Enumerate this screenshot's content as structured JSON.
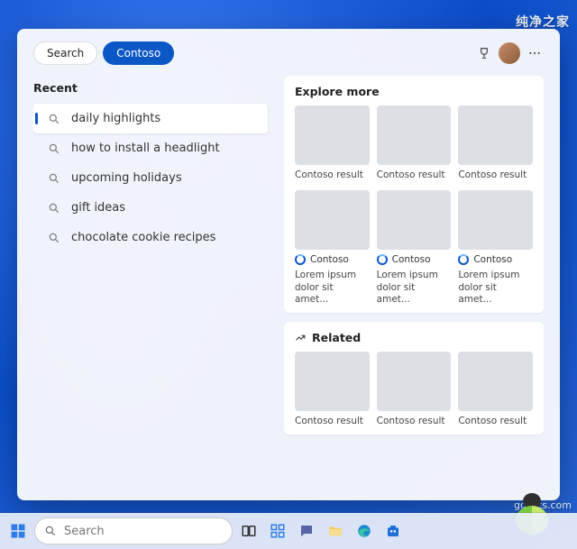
{
  "header": {
    "tab_search": "Search",
    "tab_contoso": "Contoso"
  },
  "recent": {
    "title": "Recent",
    "items": [
      "daily highlights",
      "how to install a headlight",
      "upcoming holidays",
      "gift ideas",
      "chocolate cookie recipes"
    ]
  },
  "explore": {
    "title": "Explore more",
    "row1": [
      {
        "caption": "Contoso result"
      },
      {
        "caption": "Contoso result"
      },
      {
        "caption": "Contoso result"
      }
    ],
    "row2": [
      {
        "badge": "Contoso",
        "caption": "Lorem ipsum dolor sit amet..."
      },
      {
        "badge": "Contoso",
        "caption": "Lorem ipsum dolor sit amet..."
      },
      {
        "badge": "Contoso",
        "caption": "Lorem ipsum dolor sit amet..."
      }
    ]
  },
  "related": {
    "title": "Related",
    "items": [
      {
        "caption": "Contoso result"
      },
      {
        "caption": "Contoso result"
      },
      {
        "caption": "Contoso result"
      }
    ]
  },
  "taskbar": {
    "search_placeholder": "Search"
  },
  "watermarks": {
    "top": "纯净之家",
    "bottom": "gdhtcs.com"
  }
}
